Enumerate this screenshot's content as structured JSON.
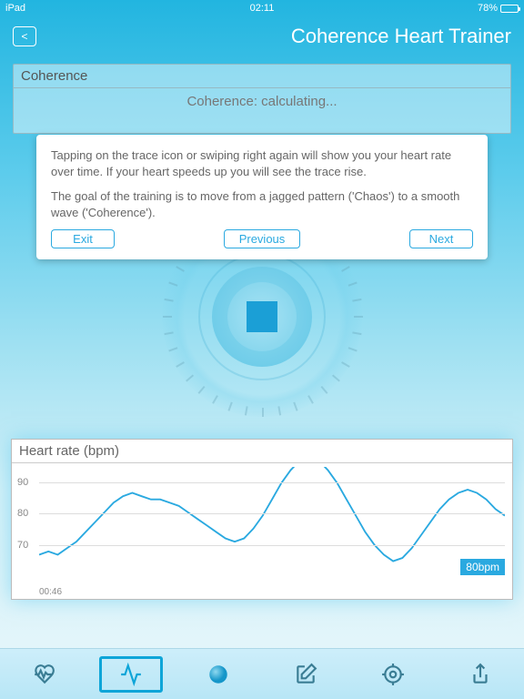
{
  "status": {
    "device": "iPad",
    "time": "02:11",
    "battery_pct": "78%"
  },
  "nav": {
    "back_glyph": "<",
    "title": "Coherence Heart Trainer"
  },
  "coherence_panel": {
    "header": "Coherence",
    "status": "Coherence: calculating..."
  },
  "tip": {
    "para1": "Tapping on the trace icon or swiping right again will show you your heart rate over time. If your heart speeds up you will see the trace rise.",
    "para2": "The goal of the training is to move from a jagged pattern ('Chaos') to a smooth wave ('Coherence').",
    "exit": "Exit",
    "previous": "Previous",
    "next": "Next"
  },
  "chart_data": {
    "type": "line",
    "title": "Heart rate (bpm)",
    "ylabel": "bpm",
    "ylim": [
      60,
      95
    ],
    "y_ticks": [
      70,
      80,
      90
    ],
    "x_start_label": "00:46",
    "current_label": "80bpm",
    "x": [
      0,
      2,
      4,
      6,
      8,
      10,
      12,
      14,
      16,
      18,
      20,
      22,
      24,
      26,
      28,
      30,
      32,
      34,
      36,
      38,
      40,
      42,
      44,
      46,
      48,
      50,
      52,
      54,
      56,
      58,
      60,
      62,
      64,
      66,
      68,
      70,
      72,
      74,
      76,
      78,
      80,
      82,
      84,
      86,
      88,
      90,
      92,
      94,
      96,
      98,
      100
    ],
    "values": [
      68,
      69,
      68,
      70,
      72,
      75,
      78,
      81,
      84,
      86,
      87,
      86,
      85,
      85,
      84,
      83,
      81,
      79,
      77,
      75,
      73,
      72,
      73,
      76,
      80,
      85,
      90,
      94,
      97,
      98,
      97,
      94,
      90,
      85,
      80,
      75,
      71,
      68,
      66,
      67,
      70,
      74,
      78,
      82,
      85,
      87,
      88,
      87,
      85,
      82,
      80
    ]
  },
  "tabs": {
    "heart": "heart-tab",
    "trace": "trace-tab",
    "globe": "globe-tab",
    "compose": "compose-tab",
    "target": "target-tab",
    "share": "share-tab"
  }
}
